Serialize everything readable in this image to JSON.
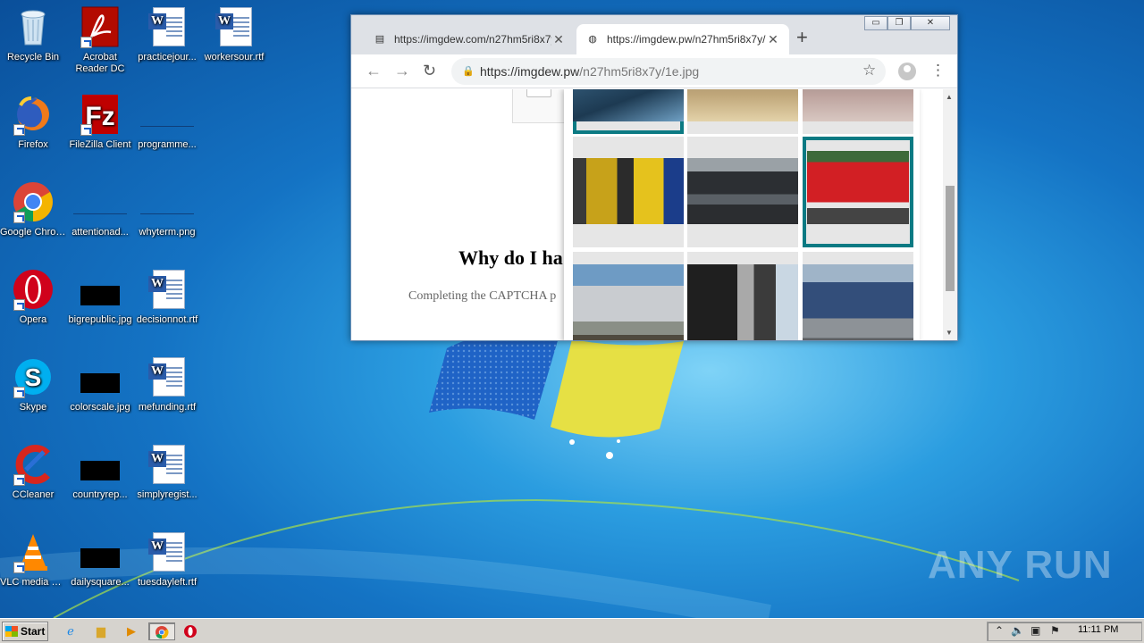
{
  "desktop": {
    "icons": [
      {
        "label": "Recycle Bin",
        "type": "recycle-bin"
      },
      {
        "label": "Acrobat Reader DC",
        "type": "acrobat"
      },
      {
        "label": "practicejour...",
        "type": "word"
      },
      {
        "label": "workersour.rtf",
        "type": "word"
      },
      {
        "label": "Firefox",
        "type": "firefox"
      },
      {
        "label": "FileZilla Client",
        "type": "filezilla"
      },
      {
        "label": "programme...",
        "type": "blue-image"
      },
      {
        "label": "Google Chrome",
        "type": "chrome"
      },
      {
        "label": "attentionad...",
        "type": "blue-image"
      },
      {
        "label": "whyterm.png",
        "type": "blue-image"
      },
      {
        "label": "Opera",
        "type": "opera"
      },
      {
        "label": "bigrepublic.jpg",
        "type": "black-image"
      },
      {
        "label": "decisionnot.rtf",
        "type": "word"
      },
      {
        "label": "Skype",
        "type": "skype"
      },
      {
        "label": "colorscale.jpg",
        "type": "black-image"
      },
      {
        "label": "mefunding.rtf",
        "type": "word"
      },
      {
        "label": "CCleaner",
        "type": "ccleaner"
      },
      {
        "label": "countryrep...",
        "type": "black-image"
      },
      {
        "label": "simplyregist...",
        "type": "word"
      },
      {
        "label": "VLC media player",
        "type": "vlc"
      },
      {
        "label": "dailysquare...",
        "type": "black-image"
      },
      {
        "label": "tuesdayleft.rtf",
        "type": "word"
      }
    ]
  },
  "browser": {
    "tabs": [
      {
        "title": "https://imgdew.com/n27hm5ri8x7y/1",
        "close": "✕",
        "active": false
      },
      {
        "title": "https://imgdew.pw/n27hm5ri8x7y/1e.jpg",
        "close": "✕",
        "active": true
      }
    ],
    "new_tab": "+",
    "window_buttons": {
      "minimize": "▭",
      "restore": "❐",
      "close": "✕"
    },
    "address": {
      "domain": "https://imgdew.pw",
      "path": "/n27hm5ri8x7y/1e.jpg"
    },
    "page": {
      "heading": "Why do I ha",
      "subtext": "Completing the CAPTCHA p"
    },
    "captcha_tiles": [
      {
        "row": 0,
        "col": 0,
        "selected": true,
        "scene": "car-door"
      },
      {
        "row": 0,
        "col": 1,
        "selected": false,
        "scene": "street"
      },
      {
        "row": 0,
        "col": 2,
        "selected": false,
        "scene": "pavement"
      },
      {
        "row": 1,
        "col": 0,
        "selected": false,
        "scene": "truck-yellow"
      },
      {
        "row": 1,
        "col": 1,
        "selected": false,
        "scene": "car-side"
      },
      {
        "row": 1,
        "col": 2,
        "selected": true,
        "scene": "fire-truck"
      },
      {
        "row": 2,
        "col": 0,
        "selected": false,
        "scene": "train"
      },
      {
        "row": 2,
        "col": 1,
        "selected": false,
        "scene": "bus-door"
      },
      {
        "row": 2,
        "col": 2,
        "selected": false,
        "scene": "truck-blue"
      }
    ]
  },
  "watermark": "ANY RUN",
  "taskbar": {
    "start_label": "Start",
    "pinned": [
      "ie",
      "explorer",
      "media-player",
      "chrome",
      "opera"
    ],
    "clock": "11:11 PM"
  }
}
